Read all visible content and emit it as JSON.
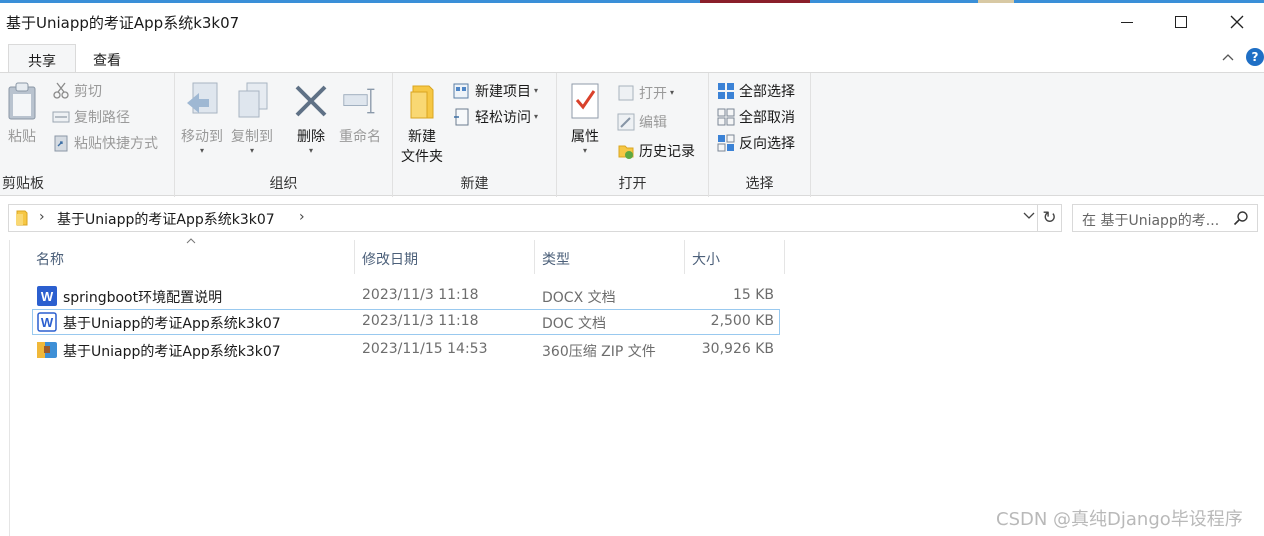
{
  "window": {
    "title": "基于Uniapp的考证App系统k3k07",
    "minimize_icon": "minimize-icon",
    "maximize_icon": "maximize-icon",
    "close_icon": "close-icon"
  },
  "ribbon_tabs": [
    {
      "label": "共享",
      "active": true
    },
    {
      "label": "查看",
      "active": false
    }
  ],
  "ribbon": {
    "collapse_glyph": "^",
    "help_glyph": "?",
    "clipboard": {
      "label": "剪贴板",
      "paste": "粘贴",
      "cut": "剪切",
      "copy_path": "复制路径",
      "paste_shortcut": "粘贴快捷方式"
    },
    "organize": {
      "label": "组织",
      "move_to": "移动到",
      "copy_to": "复制到",
      "delete": "删除",
      "rename": "重命名"
    },
    "new": {
      "label": "新建",
      "new_folder_line1": "新建",
      "new_folder_line2": "文件夹",
      "new_item": "新建项目",
      "easy_access": "轻松访问"
    },
    "open": {
      "label": "打开",
      "properties": "属性",
      "open": "打开",
      "edit": "编辑",
      "history": "历史记录"
    },
    "select": {
      "label": "选择",
      "select_all": "全部选择",
      "select_none": "全部取消",
      "invert": "反向选择"
    }
  },
  "address": {
    "path": "基于Uniapp的考证App系统k3k07",
    "search_placeholder": "在 基于Uniapp的考..."
  },
  "columns": {
    "name": "名称",
    "date": "修改日期",
    "type": "类型",
    "size": "大小"
  },
  "files": [
    {
      "name": "springboot环境配置说明",
      "date": "2023/11/3 11:18",
      "type": "DOCX 文档",
      "size": "15 KB",
      "icon": "word-docx-icon"
    },
    {
      "name": "基于Uniapp的考证App系统k3k07",
      "date": "2023/11/3 11:18",
      "type": "DOC 文档",
      "size": "2,500 KB",
      "icon": "word-doc-icon",
      "selected": true
    },
    {
      "name": "基于Uniapp的考证App系统k3k07",
      "date": "2023/11/15 14:53",
      "type": "360压缩 ZIP 文件",
      "size": "30,926 KB",
      "icon": "zip-archive-icon"
    }
  ],
  "watermark": "CSDN @真纯Django毕设程序",
  "colors": {
    "accent": "#1f6fc5",
    "selection_border": "#99c9ef",
    "ribbon_bg": "#f5f6f7"
  }
}
